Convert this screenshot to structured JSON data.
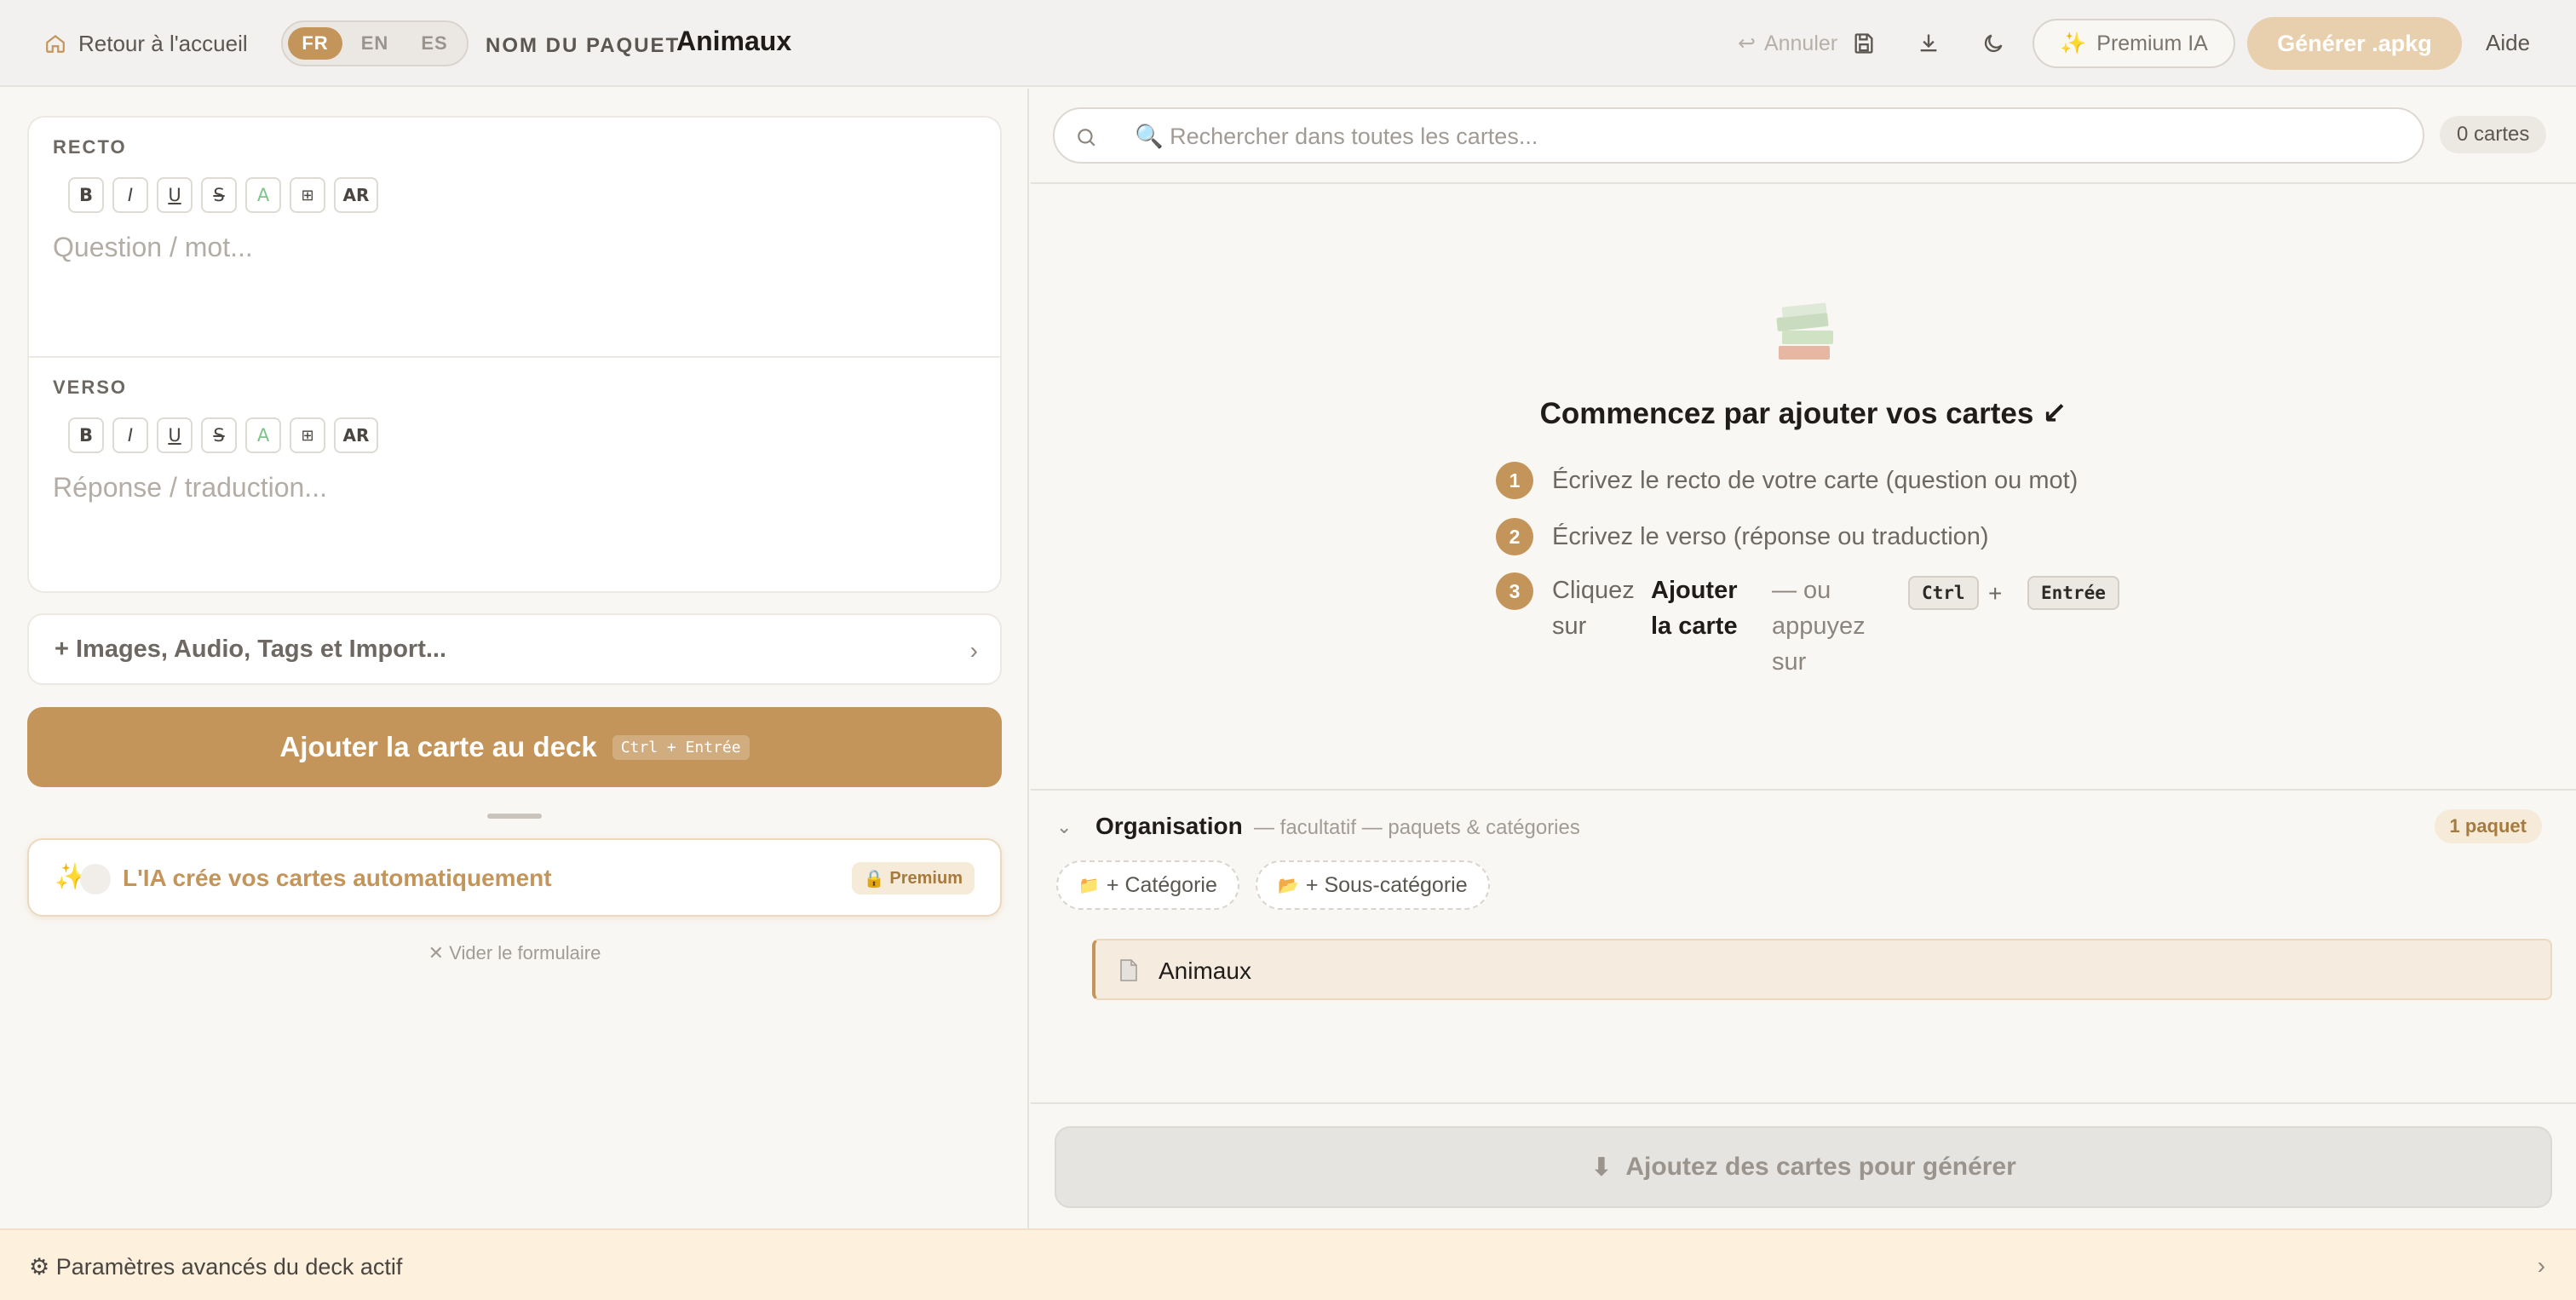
{
  "header": {
    "back_label": "Retour à l'accueil",
    "languages": [
      "FR",
      "EN",
      "ES"
    ],
    "active_language": "FR",
    "deck_label": "NOM DU PAQUET",
    "deck_name": "Animaux",
    "undo_label": "Annuler",
    "premium_label": "Premium IA",
    "generate_label": "Générer .apkg",
    "help_label": "Aide"
  },
  "editor": {
    "recto_label": "RECTO",
    "verso_label": "VERSO",
    "recto_placeholder": "Question / mot...",
    "verso_placeholder": "Réponse / traduction...",
    "toolbar": [
      "B",
      "I",
      "U",
      "S",
      "A",
      "⊞",
      "AR"
    ]
  },
  "extras": {
    "label": "+ Images, Audio, Tags et Import...",
    "chevron": "›"
  },
  "add_card": {
    "label": "Ajouter la carte au deck",
    "shortcut": "Ctrl + Entrée"
  },
  "ai_card": {
    "label": "L'IA crée vos cartes automatiquement",
    "badge": "Premium"
  },
  "clear_form": "✕ Vider le formulaire",
  "search": {
    "placeholder": "🔍 Rechercher dans toutes les cartes...",
    "count": "0 cartes"
  },
  "empty_state": {
    "title": "Commencez par ajouter vos cartes ↙",
    "steps": [
      {
        "num": "1",
        "text": "Écrivez le recto de votre carte (question ou mot)"
      },
      {
        "num": "2",
        "text": "Écrivez le verso (réponse ou traduction)"
      },
      {
        "num": "3",
        "text_a": "Cliquez sur",
        "text_b": "Ajouter la carte",
        "text_c": "— ou appuyez sur",
        "key1": "Ctrl",
        "plus": "+",
        "key2": "Entrée"
      }
    ]
  },
  "organisation": {
    "title": "Organisation",
    "subtitle": "— facultatif — paquets & catégories",
    "badge": "1 paquet",
    "add_category": "+ Catégorie",
    "add_subcategory": "+ Sous-catégorie",
    "decks": [
      {
        "name": "Animaux"
      }
    ]
  },
  "generate_disabled": "Ajoutez des cartes pour générer",
  "footer": {
    "label": "⚙ Paramètres avancés du deck actif",
    "chevron": "›"
  },
  "colors": {
    "accent": "#c4955a",
    "accent_light": "#e8cfad",
    "background": "#f9f7f3"
  }
}
